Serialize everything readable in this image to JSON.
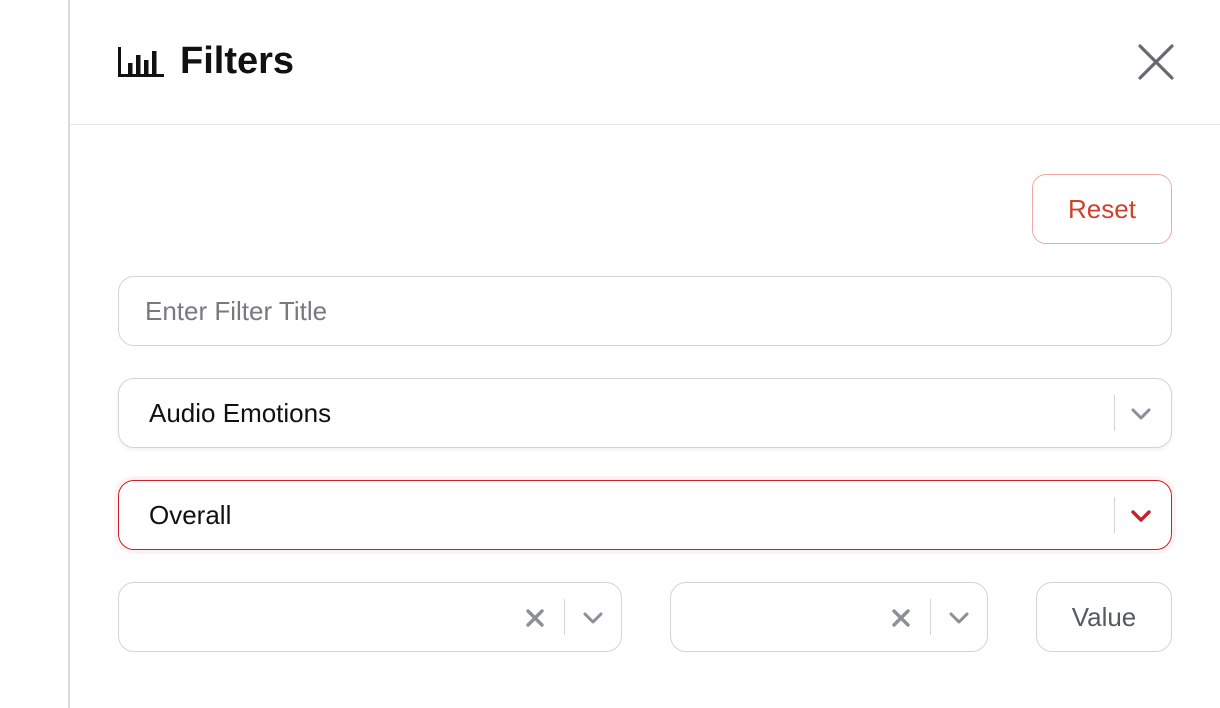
{
  "header": {
    "title": "Filters",
    "title_icon": "bar-chart-icon",
    "close_icon": "close-icon"
  },
  "actions": {
    "reset_label": "Reset"
  },
  "filter_title_input": {
    "value": "",
    "placeholder": "Enter Filter Title"
  },
  "category_select": {
    "selected": "Audio Emotions",
    "icon": "chevron-down-icon"
  },
  "scope_select": {
    "selected": "Overall",
    "icon": "chevron-down-icon",
    "state": "focused"
  },
  "operator_select": {
    "selected": "",
    "clear_icon": "clear-x-icon",
    "icon": "chevron-down-icon"
  },
  "comparison_select": {
    "selected": "",
    "clear_icon": "clear-x-icon",
    "icon": "chevron-down-icon"
  },
  "value_button": {
    "label": "Value"
  },
  "colors": {
    "accent_red": "#c9202a",
    "reset_text": "#d0402e",
    "reset_border": "#f0a9a0",
    "border_gray": "#d3d3dc",
    "icon_gray": "#8a8f9a"
  }
}
